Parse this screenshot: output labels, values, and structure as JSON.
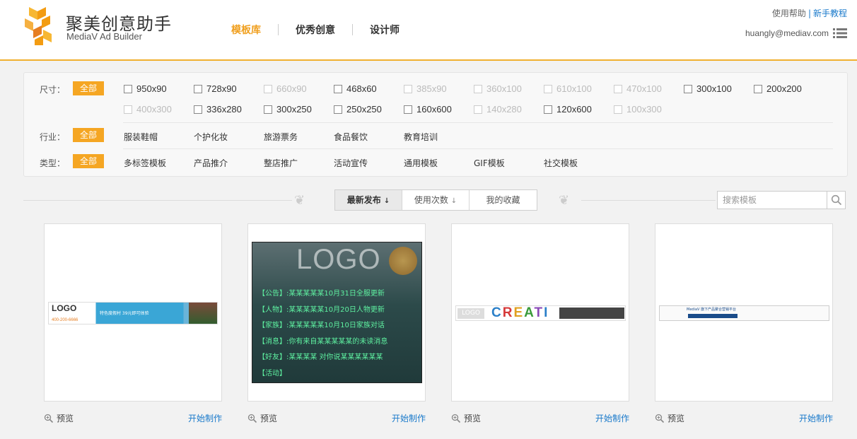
{
  "header": {
    "brand_cn": "聚美创意助手",
    "brand_en": "MediaV Ad Builder",
    "nav": [
      "模板库",
      "优秀创意",
      "设计师"
    ],
    "help": "使用帮助",
    "separator": "|",
    "tutorial": "新手教程",
    "user": "huangly@mediav.com"
  },
  "filters": {
    "size_label": "尺寸：",
    "industry_label": "行业：",
    "type_label": "类型：",
    "all": "全部",
    "sizes_row1": [
      "950x90",
      "728x90",
      "660x90",
      "468x60",
      "385x90",
      "360x100",
      "610x100",
      "470x100",
      "300x100",
      "200x200"
    ],
    "sizes_row2": [
      "400x300",
      "336x280",
      "300x250",
      "250x250",
      "160x600",
      "140x280",
      "120x600",
      "100x300"
    ],
    "industries": [
      "服装鞋帽",
      "个护化妆",
      "旅游票务",
      "食品餐饮",
      "教育培训"
    ],
    "types": [
      "多标签模板",
      "产品推介",
      "整店推广",
      "活动宣传",
      "通用模板",
      "GIF模板",
      "社交模板"
    ]
  },
  "sort": {
    "tabs": [
      "最新发布",
      "使用次数",
      "我的收藏"
    ],
    "arrow": "↓"
  },
  "search": {
    "placeholder": "搜索模板"
  },
  "cards": {
    "preview": "预览",
    "start": "开始制作"
  },
  "card1": {
    "logo": "LOGO",
    "phone": "400-200-6666",
    "slogan": "特色度假村 39元即可体验"
  },
  "card2": {
    "logo": "LOGO",
    "lines": [
      "【公告】:某某某某某10月31日全服更新",
      "【人物】:某某某某某10月20日人物更新",
      "【家族】:某某某某某10月10日家族对话",
      "【消息】:你有来自某某某某某的未读消息",
      "【好友】:某某某某 对你说某某某某某某",
      "【活动】"
    ]
  },
  "card3": {
    "logo": "LOGO",
    "word": "CREATI"
  },
  "card4": {
    "brand": "MediaV 旗下产品聚合营销平台"
  },
  "colors": {
    "accent": "#f5a623",
    "link": "#1a7acb",
    "header_border": "#f0b030"
  },
  "icons": {
    "menu": "list-menu-icon",
    "search": "magnifier-icon",
    "preview": "zoom-in-icon",
    "ornament": "ornament-icon"
  }
}
